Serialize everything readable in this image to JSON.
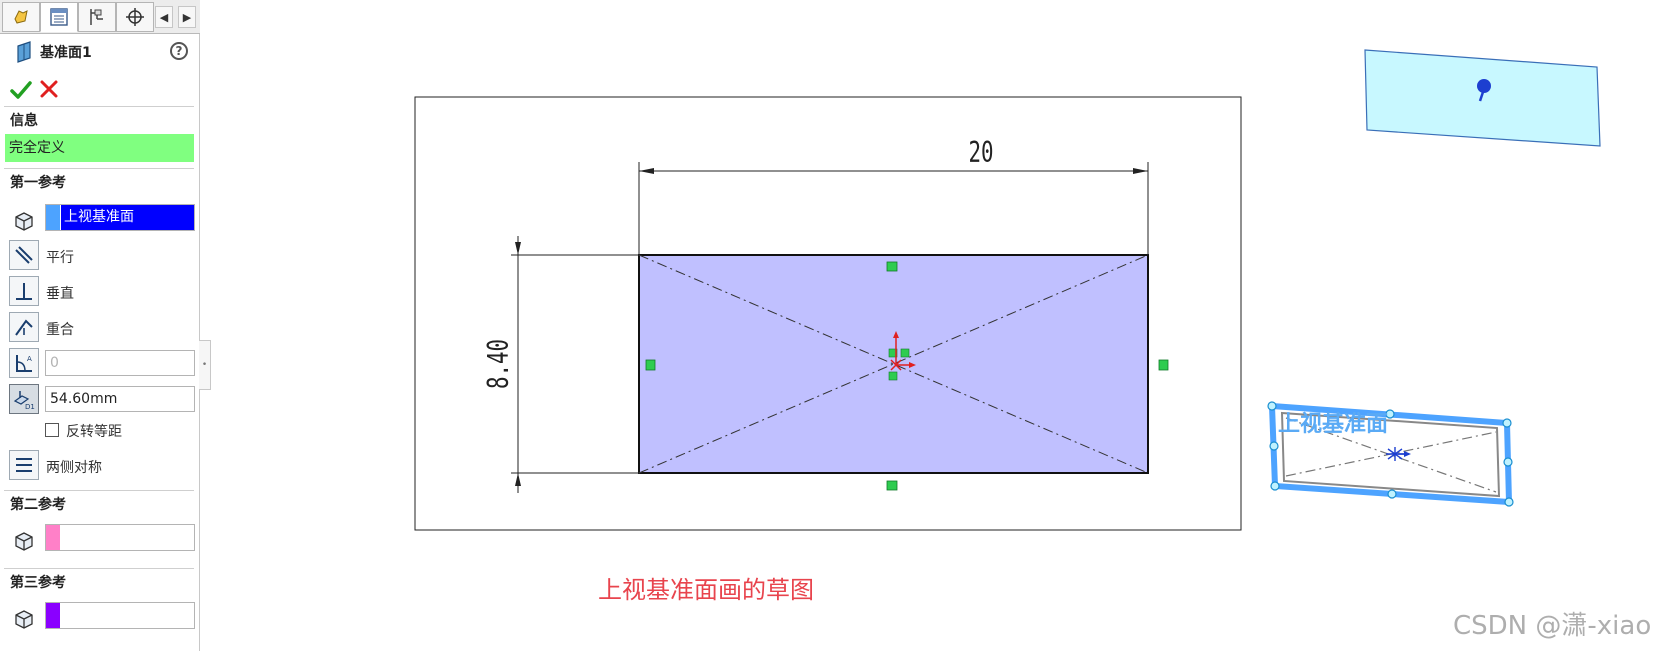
{
  "panel": {
    "tabs": [
      "feature-manager",
      "property-manager",
      "configuration-manager",
      "dimxpert-manager"
    ],
    "title": "基准面1",
    "help_glyph": "?",
    "sections": {
      "info": "信息",
      "first_ref": "第一参考",
      "second_ref": "第二参考",
      "third_ref": "第三参考"
    },
    "status": "完全定义",
    "first_ref": {
      "value": "上视基准面",
      "swatch_color": "#4da3ff",
      "options": {
        "parallel": "平行",
        "perpendicular": "垂直",
        "coincident": "重合"
      },
      "angle_value": "0",
      "distance_value": "54.60mm",
      "flip_label": "反转等距",
      "mirror_label": "两侧对称"
    },
    "second_ref": {
      "value": "",
      "swatch_color": "#ff80c8"
    },
    "third_ref": {
      "value": "",
      "swatch_color": "#8a00ff"
    }
  },
  "sketch": {
    "dim_horizontal": "20",
    "dim_vertical": "8.40",
    "fill_color": "#c0c0ff"
  },
  "preview_plane": {
    "fill_color": "#c8f8ff"
  },
  "top_plane": {
    "label": "上视基准面",
    "color": "#4da3ff"
  },
  "caption": "上视基准面画的草图",
  "watermark": "CSDN @潇-xiao"
}
